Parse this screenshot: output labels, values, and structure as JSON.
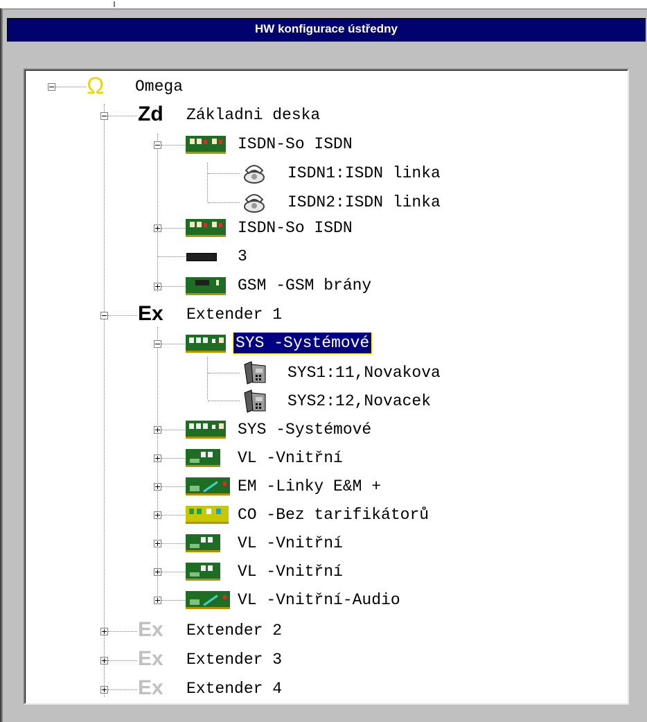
{
  "window": {
    "title": "HW konfigurace ústředny"
  },
  "tree": {
    "root": {
      "label": "Omega",
      "icon": "omega-icon",
      "icon_color": "#f2d400"
    },
    "zd": {
      "icon_text": "Zd",
      "label": "Základni deska"
    },
    "zd_isdn1": {
      "label": "ISDN-So ISDN"
    },
    "zd_isdn1_line1": {
      "label": "ISDN1:ISDN linka"
    },
    "zd_isdn1_line2": {
      "label": "ISDN2:ISDN linka"
    },
    "zd_isdn2": {
      "label": "ISDN-So ISDN"
    },
    "zd_slot3": {
      "label": "3"
    },
    "zd_gsm": {
      "label": "GSM -GSM brány"
    },
    "ex1": {
      "icon_text": "Ex",
      "label": "Extender 1"
    },
    "ex1_sys1": {
      "label": "SYS -Systémové",
      "selected": true
    },
    "ex1_sys1_ext1": {
      "label": "SYS1:11,Novakova"
    },
    "ex1_sys1_ext2": {
      "label": "SYS2:12,Novacek"
    },
    "ex1_sys2": {
      "label": "SYS -Systémové"
    },
    "ex1_vl1": {
      "label": "VL  -Vnitřní"
    },
    "ex1_em": {
      "label": "EM  -Linky E&M +"
    },
    "ex1_co": {
      "label": "CO  -Bez tarifikátorů"
    },
    "ex1_vl2": {
      "label": "VL  -Vnitřní"
    },
    "ex1_vl3": {
      "label": "VL  -Vnitřní"
    },
    "ex1_vl_audio": {
      "label": "VL  -Vnitřní-Audio"
    },
    "ex2": {
      "icon_text": "Ex",
      "label": "Extender 2"
    },
    "ex3": {
      "icon_text": "Ex",
      "label": "Extender 3"
    },
    "ex4": {
      "icon_text": "Ex",
      "label": "Extender 4"
    }
  },
  "colors": {
    "title_bg": "#02026f",
    "selection_bg": "#000080",
    "card_green": "#1d6e24",
    "inactive_extender": "#c0c0c0"
  }
}
